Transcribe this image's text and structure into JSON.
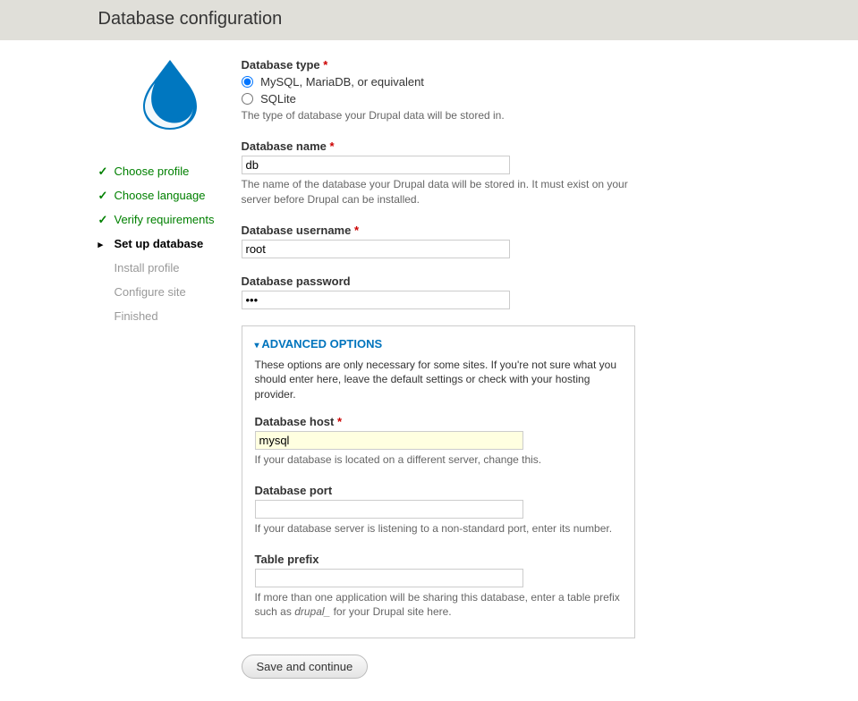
{
  "header": {
    "title": "Database configuration"
  },
  "steps": [
    {
      "label": "Choose profile",
      "state": "done"
    },
    {
      "label": "Choose language",
      "state": "done"
    },
    {
      "label": "Verify requirements",
      "state": "done"
    },
    {
      "label": "Set up database",
      "state": "active"
    },
    {
      "label": "Install profile",
      "state": "pending"
    },
    {
      "label": "Configure site",
      "state": "pending"
    },
    {
      "label": "Finished",
      "state": "pending"
    }
  ],
  "db_type": {
    "label": "Database type",
    "options": [
      {
        "label": "MySQL, MariaDB, or equivalent",
        "checked": true
      },
      {
        "label": "SQLite",
        "checked": false
      }
    ],
    "description": "The type of database your Drupal data will be stored in."
  },
  "db_name": {
    "label": "Database name",
    "value": "db",
    "description": "The name of the database your Drupal data will be stored in. It must exist on your server before Drupal can be installed."
  },
  "db_user": {
    "label": "Database username",
    "value": "root"
  },
  "db_pass": {
    "label": "Database password",
    "value": "•••"
  },
  "advanced": {
    "legend": "ADVANCED OPTIONS",
    "intro": "These options are only necessary for some sites. If you're not sure what you should enter here, leave the default settings or check with your hosting provider.",
    "host": {
      "label": "Database host",
      "value": "mysql",
      "description": "If your database is located on a different server, change this."
    },
    "port": {
      "label": "Database port",
      "value": "",
      "description": "If your database server is listening to a non-standard port, enter its number."
    },
    "prefix": {
      "label": "Table prefix",
      "value": "",
      "desc_pre": "If more than one application will be sharing this database, enter a table prefix such as ",
      "desc_em": "drupal_",
      "desc_post": " for your Drupal site here."
    }
  },
  "submit": {
    "label": "Save and continue"
  }
}
